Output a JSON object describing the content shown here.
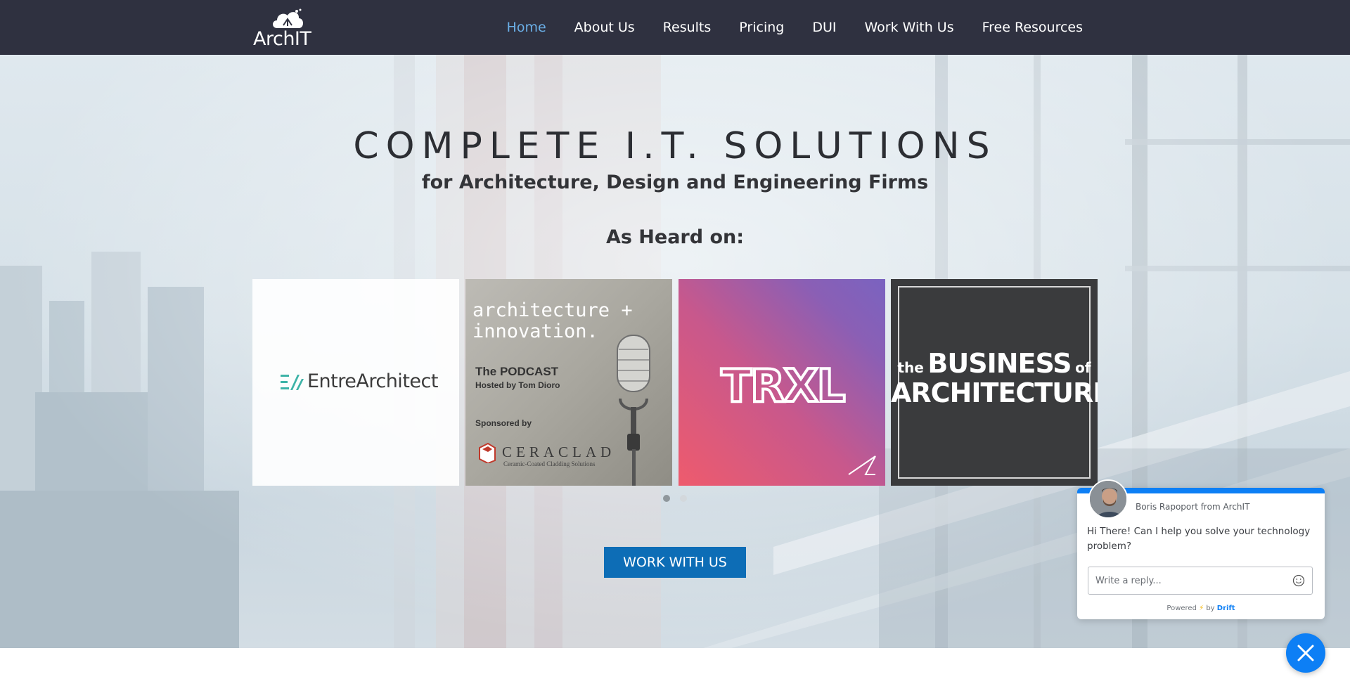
{
  "brand": {
    "name": "ArchIT"
  },
  "nav": {
    "items": [
      {
        "label": "Home",
        "active": true
      },
      {
        "label": "About Us"
      },
      {
        "label": "Results"
      },
      {
        "label": "Pricing"
      },
      {
        "label": "DUI"
      },
      {
        "label": "Work With Us"
      },
      {
        "label": "Free Resources"
      }
    ]
  },
  "hero": {
    "title": "COMPLETE I.T. SOLUTIONS",
    "subtitle": "for Architecture, Design and Engineering Firms",
    "heard_on": "As Heard on:",
    "cta": "WORK WITH US"
  },
  "carousel": {
    "slides_count": 2,
    "active_slide": 1,
    "tiles": [
      {
        "text": "EntreArchitect"
      },
      {
        "title_line1": "architecture +",
        "title_line2": "innovation.",
        "label": "The PODCAST",
        "host": "Hosted by Tom Dioro",
        "sponsor": "Sponsored by",
        "sponsor_brand": "CERACLAD",
        "sponsor_tagline": "Ceramic-Coated Cladding Solutions"
      },
      {
        "text": "TRXL"
      },
      {
        "small1": "the",
        "big1": "BUSINESS",
        "small2": "of",
        "line2": "ARCHITECTURE"
      }
    ]
  },
  "chat": {
    "agent": "Boris Rapoport from ArchIT",
    "message": "Hi There! Can I help you solve your technology problem?",
    "placeholder": "Write a reply...",
    "footer_powered": "Powered",
    "footer_by": "by",
    "footer_brand": "Drift"
  },
  "colors": {
    "nav_bg": "#2f3140",
    "nav_active": "#6aaee6",
    "cta_bg": "#0d6db6",
    "chat_accent": "#0d7ff5"
  },
  "icons": [
    "cloud-logo-icon",
    "microphone-icon",
    "smile-icon",
    "close-icon",
    "lightning-icon"
  ]
}
